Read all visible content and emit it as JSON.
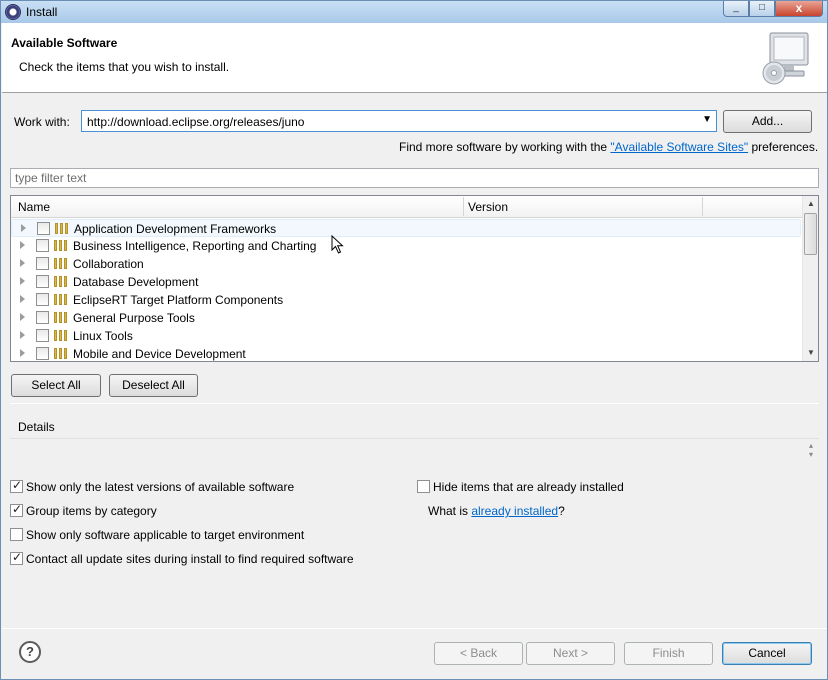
{
  "window": {
    "title": "Install",
    "close": "x",
    "min": "_",
    "max": "□"
  },
  "header": {
    "title": "Available Software",
    "subtitle": "Check the items that you wish to install."
  },
  "work_with": {
    "label": "Work with:",
    "value": "http://download.eclipse.org/releases/juno",
    "add_button": "Add..."
  },
  "more_software": {
    "prefix": "Find more software by working with the ",
    "link": "\"Available Software Sites\"",
    "suffix": " preferences."
  },
  "filter": {
    "placeholder": "type filter text"
  },
  "tree": {
    "columns": [
      "Name",
      "Version"
    ],
    "items": [
      {
        "label": "Application Development Frameworks",
        "checked": false
      },
      {
        "label": "Business Intelligence, Reporting and Charting",
        "checked": false
      },
      {
        "label": "Collaboration",
        "checked": false
      },
      {
        "label": "Database Development",
        "checked": false
      },
      {
        "label": "EclipseRT Target Platform Components",
        "checked": false
      },
      {
        "label": "General Purpose Tools",
        "checked": false
      },
      {
        "label": "Linux Tools",
        "checked": false
      },
      {
        "label": "Mobile and Device Development",
        "checked": false
      }
    ]
  },
  "selection_buttons": {
    "select_all": "Select All",
    "deselect_all": "Deselect All"
  },
  "details": {
    "title": "Details"
  },
  "options": {
    "latest_versions": {
      "label": "Show only the latest versions of available software",
      "checked": true
    },
    "hide_installed": {
      "label": "Hide items that are already installed",
      "checked": false
    },
    "group_by_category": {
      "label": "Group items by category",
      "checked": true
    },
    "what_is_prefix": "What is ",
    "what_is_link": "already installed",
    "what_is_suffix": "?",
    "target_env": {
      "label": "Show only software applicable to target environment",
      "checked": false
    },
    "contact_sites": {
      "label": "Contact all update sites during install to find required software",
      "checked": true
    }
  },
  "footer": {
    "help": "?",
    "back": "< Back",
    "next": "Next >",
    "finish": "Finish",
    "cancel": "Cancel"
  },
  "icons": {
    "app": "eclipse-icon",
    "monitor": "monitor-cd-icon",
    "category": "category-icon",
    "expander": "expand-arrow-icon",
    "combo": "dropdown-arrow-icon",
    "help": "help-icon",
    "cursor": "mouse-cursor-icon"
  }
}
